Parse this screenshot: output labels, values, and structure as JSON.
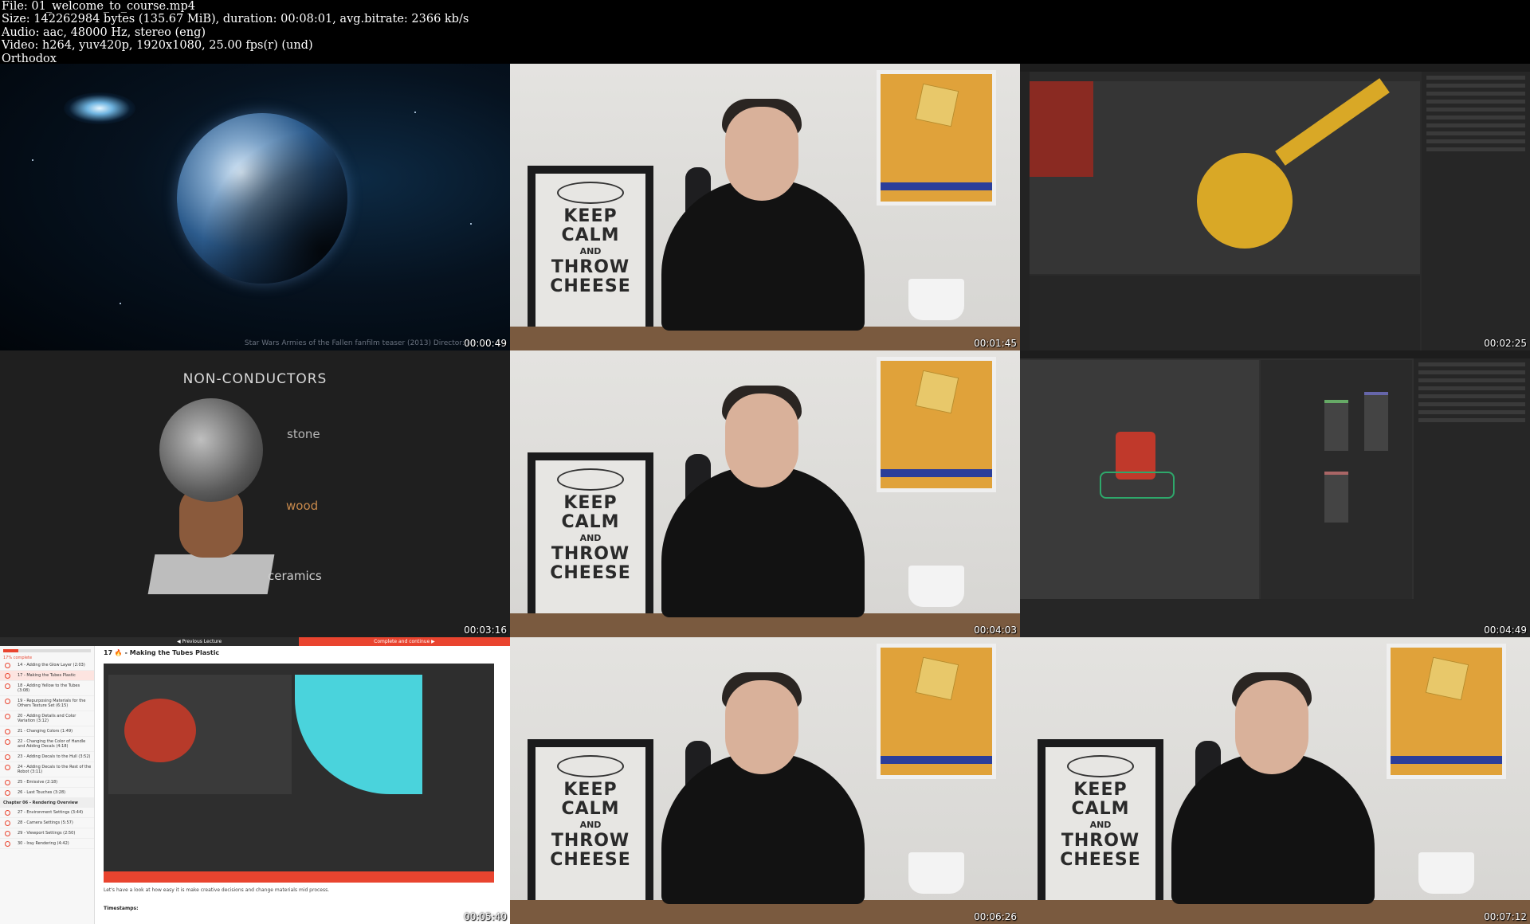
{
  "header": {
    "line1": "File: 01_welcome_to_course.mp4",
    "line2": "Size: 142262984 bytes (135.67 MiB), duration: 00:08:01, avg.bitrate: 2366 kb/s",
    "line3": "Audio: aac, 48000 Hz, stereo (eng)",
    "line4": "Video: h264, yuv420p, 1920x1080, 25.00 fps(r) (und)",
    "line5": "Orthodox"
  },
  "thumbnails": [
    {
      "timestamp": "00:00:49",
      "caption": "Star Wars Armies of the Fallen fanfilm teaser (2013) Director: Mi"
    },
    {
      "timestamp": "00:01:45"
    },
    {
      "timestamp": "00:02:25"
    },
    {
      "timestamp": "00:03:16",
      "title": "NON-CONDUCTORS",
      "labels": [
        "stone",
        "wood",
        "ceramics"
      ]
    },
    {
      "timestamp": "00:04:03"
    },
    {
      "timestamp": "00:04:49"
    },
    {
      "timestamp": "00:05:40",
      "course": {
        "prev_label": "◀ Previous Lecture",
        "next_label": "Complete and continue ▶",
        "progress_text": "17% complete",
        "lecture_title": "17 🔥 - Making the Tubes Plastic",
        "chapter": "Chapter 06 - Rendering Overview",
        "items": [
          "14 - Adding the Glow Layer (2:03)",
          "17 - Making the Tubes Plastic",
          "18 - Adding Yellow to the Tubes (3:08)",
          "19 - Repurposing Materials for the Others Texture Set (6:15)",
          "20 - Adding Details and Color Variation (3:12)",
          "21 - Changing Colors (1:49)",
          "22 - Changing the Color of Handle and Adding Decals (4:18)",
          "23 - Adding Decals to the Hull (3:52)",
          "24 - Adding Decals to the Rest of the Robot (3:11)",
          "25 - Emissive (2:18)",
          "26 - Last Touches (3:28)"
        ],
        "chapter_items": [
          "27 - Environment Settings (3:44)",
          "28 - Camera Settings (5:57)",
          "29 - Viewport Settings (2:50)",
          "30 - Iray Rendering (4:42)"
        ],
        "description": "Let's have a look at how easy it is make creative decisions and change materials mid process.",
        "timestamps_label": "Timestamps:"
      }
    },
    {
      "timestamp": "00:06:26"
    },
    {
      "timestamp": "00:07:12"
    }
  ],
  "poster_text": {
    "keep": "KEEP",
    "calm": "CALM",
    "and": "AND",
    "throw": "THROW",
    "cheese": "CHEESE"
  }
}
